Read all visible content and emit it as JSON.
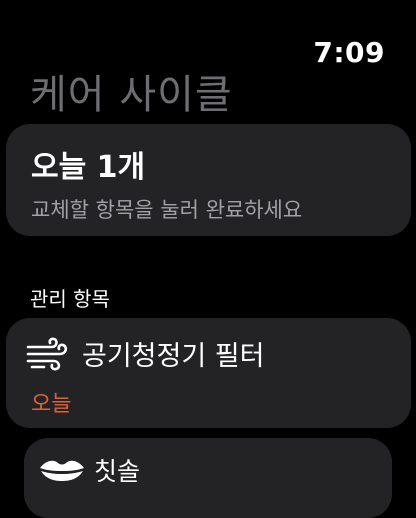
{
  "status": {
    "time": "7:09"
  },
  "page": {
    "title": "케어 사이클"
  },
  "summary": {
    "title": "오늘 1개",
    "subtitle": "교체할 항목을 눌러 완료하세요"
  },
  "section": {
    "header": "관리 항목"
  },
  "items": [
    {
      "name": "공기청정기 필터",
      "due": "오늘",
      "icon": "wind-icon",
      "due_color": "#e0603a"
    },
    {
      "name": "칫솔",
      "icon": "lips-icon"
    }
  ],
  "colors": {
    "background": "#000000",
    "card": "#232325",
    "title_gray": "#6d6d72",
    "subtitle_gray": "#a1a1a6",
    "accent_orange": "#e0603a"
  }
}
